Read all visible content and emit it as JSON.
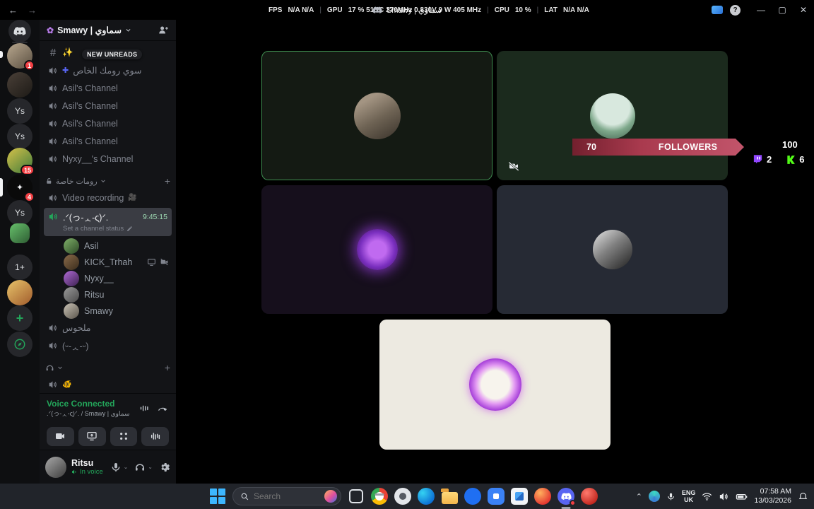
{
  "theme": {
    "speaking_green": "#23a55a",
    "banner_red": "#b13246",
    "twitch_purple": "#9146ff",
    "kick_green": "#53fc18",
    "badge_red": "#f23f43"
  },
  "titlebar": {
    "title": "Smawy | سماوي",
    "stats": [
      {
        "label": "FPS",
        "value": "N/A N/A"
      },
      {
        "label": "GPU",
        "value": "17 % 51 °C 270MHz 0.830V 9 W 405 MHz"
      },
      {
        "label": "CPU",
        "value": "10 %"
      },
      {
        "label": "LAT",
        "value": "N/A N/A"
      }
    ],
    "window_controls": {
      "help": "?",
      "minimize": "—",
      "maximize": "▢",
      "close": "✕"
    }
  },
  "server_rail": {
    "ys1": "Ys",
    "ys2": "Ys",
    "ys3": "Ys",
    "more": "1+",
    "badge1": "1",
    "badge2": "15",
    "badge3": "4",
    "add": "+"
  },
  "sidebar": {
    "server_name": "Smawy | سماوي",
    "new_unreads": "NEW UNREADS",
    "channels": [
      {
        "name": "✨"
      },
      {
        "name": "سوي رومك الخاص",
        "emoji": "✚"
      },
      {
        "name": "Asil's Channel"
      },
      {
        "name": "Asil's Channel"
      },
      {
        "name": "Asil's Channel"
      },
      {
        "name": "Asil's Channel"
      },
      {
        "name": "Nyxy__'s Channel"
      }
    ],
    "category_private": "رومات خاصة",
    "video_channel": "Video recording",
    "video_channel_emoji": "🎥",
    "active_channel": {
      "name": ".ᐟ(っ-ᆺ-ς)ᐟ.",
      "timer": "9:45:15",
      "status_hint": "Set a channel status"
    },
    "members": [
      {
        "name": "Asil"
      },
      {
        "name": "KICK_Trhah"
      },
      {
        "name": "Nyxy__"
      },
      {
        "name": "Ritsu"
      },
      {
        "name": "Smawy"
      }
    ],
    "channel_melhous": "ملحوس",
    "channel_face": "(ᵕ-ᆺ-ᵕ)",
    "channel_emoji": "🐠"
  },
  "voice_panel": {
    "status": "Voice Connected",
    "path": ".ᐟ(っ-ᆺ-ς)ᐟ. / Smawy | سماوي"
  },
  "user_panel": {
    "username": "Ritsu",
    "status": "In voice"
  },
  "stream_overlay": {
    "followers_value": "70",
    "followers_label": "FOLLOWERS",
    "total_count": "100",
    "twitch_count": "2",
    "kick_count": "6"
  },
  "taskbar": {
    "search_placeholder": "Search",
    "tray": {
      "lang_top": "ENG",
      "lang_bottom": "UK",
      "time": "07:58 AM",
      "date": "13/03/2026"
    }
  }
}
